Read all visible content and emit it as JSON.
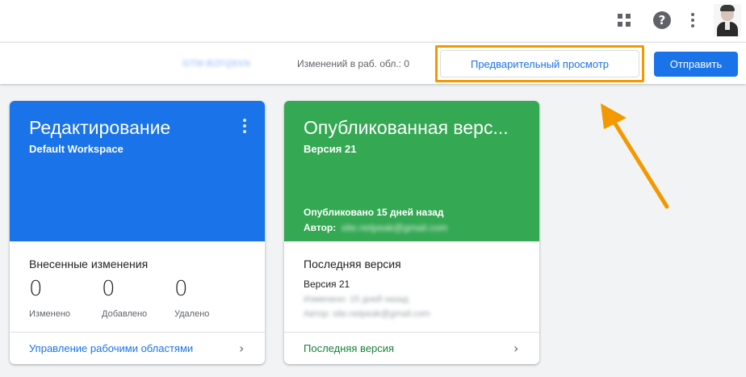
{
  "header": {
    "icons": [
      "apps-icon",
      "help-icon",
      "more-vert-icon",
      "avatar"
    ],
    "help_glyph": "?"
  },
  "toolbar": {
    "workspace_name": "GTM-BZFQ8XN",
    "changes_label": "Изменений в раб. обл.: 0",
    "preview_label": "Предварительный просмотр",
    "submit_label": "Отправить",
    "highlight_color": "#f29900"
  },
  "cards": {
    "editing": {
      "title": "Редактирование",
      "subtitle": "Default Workspace",
      "color": "#1a73e8",
      "section_title": "Внесенные изменения",
      "stats": [
        {
          "value": "0",
          "label": "Изменено"
        },
        {
          "value": "0",
          "label": "Добавлено"
        },
        {
          "value": "0",
          "label": "Удалено"
        }
      ],
      "footer_link": "Управление рабочими областями",
      "footer_chevron": "›"
    },
    "published": {
      "title": "Опубликованная верс...",
      "subtitle": "Версия 21",
      "color": "#34a853",
      "published_line": "Опубликовано 15 дней назад",
      "author_label": "Автор:",
      "author_email": "site.netpeak@gmail.com",
      "section_title": "Последняя версия",
      "version_line": "Версия 21",
      "blurred_line_1": "Изменено: 15 дней назад",
      "blurred_line_2": "Автор: site.netpeak@gmail.com",
      "footer_link": "Последняя версия",
      "footer_chevron": "›"
    }
  },
  "annotation": {
    "arrow_color": "#f29900"
  }
}
